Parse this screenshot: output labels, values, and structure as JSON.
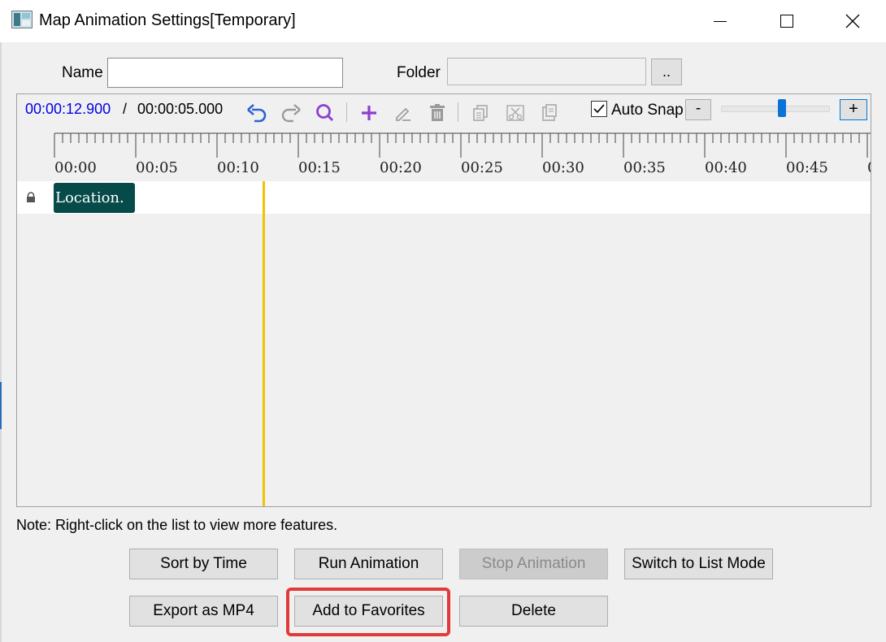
{
  "window": {
    "title": "Map Animation Settings[Temporary]"
  },
  "form": {
    "name_label": "Name",
    "name_value": "",
    "folder_label": "Folder",
    "folder_value": "",
    "browse_label": ".."
  },
  "timeline": {
    "current_time": "00:00:12.900",
    "separator": "/",
    "total_time": "00:00:05.000",
    "toolbar_icons": [
      "undo-icon",
      "redo-icon",
      "search-icon",
      "add-icon",
      "edit-icon",
      "delete-icon",
      "copy-icon",
      "cut-icon",
      "paste-icon"
    ],
    "auto_snap_label": "Auto Snap",
    "auto_snap_checked": true,
    "zoom_minus_label": "-",
    "zoom_plus_label": "+",
    "tick_labels": [
      "00:00",
      "00:05",
      "00:10",
      "00:15",
      "00:20",
      "00:25",
      "00:30",
      "00:35",
      "00:40",
      "00:45",
      "0"
    ],
    "tracks": [
      {
        "clip_label": "Location."
      }
    ]
  },
  "note": "Note: Right-click on the list to view more features.",
  "buttons": {
    "sort_by_time": "Sort by Time",
    "run_animation": "Run Animation",
    "stop_animation": "Stop Animation",
    "switch_to_list_mode": "Switch to List Mode",
    "export_as_mp4": "Export as MP4",
    "add_to_favorites": "Add to Favorites",
    "delete": "Delete"
  },
  "colors": {
    "current_time": "#0000e6",
    "clip_background": "#064a4a",
    "playhead": "#f2c200",
    "highlight": "#e23a3a",
    "accent": "#0a74d6"
  }
}
